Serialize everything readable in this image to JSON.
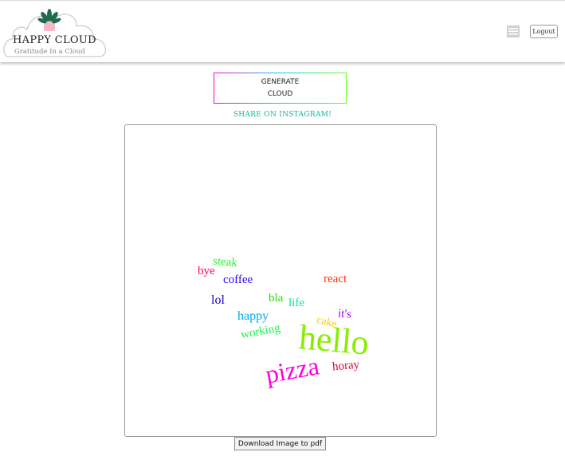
{
  "header": {
    "logo_title": "HAPPY CLOUD",
    "logo_tagline": "Gratitude In a Cloud",
    "logout_label": "Logout",
    "menu_icon": "hamburger-menu-icon"
  },
  "main": {
    "generate_line1": "GENERATE",
    "generate_line2": "CLOUD",
    "share_label": "SHARE ON INSTAGRAM!",
    "download_label": "Download Image to pdf"
  },
  "word_cloud": {
    "words": [
      {
        "text": "steak",
        "color": "#33ee33"
      },
      {
        "text": "bye",
        "color": "#ff0066"
      },
      {
        "text": "coffee",
        "color": "#3300ff"
      },
      {
        "text": "react",
        "color": "#ff3300"
      },
      {
        "text": "lol",
        "color": "#1a00cc"
      },
      {
        "text": "bla",
        "color": "#22dd00"
      },
      {
        "text": "life",
        "color": "#00ee99"
      },
      {
        "text": "happy",
        "color": "#00aaee"
      },
      {
        "text": "it's",
        "color": "#aa00ff"
      },
      {
        "text": "cake",
        "color": "#ffcc00"
      },
      {
        "text": "working",
        "color": "#22ee55"
      },
      {
        "text": "hello",
        "color": "#88ee00"
      },
      {
        "text": "pizza",
        "color": "#ff00dd"
      },
      {
        "text": "horay",
        "color": "#ee0033"
      }
    ]
  },
  "colors": {
    "share_link": "#10b99a",
    "button_border_gradient": [
      "#ff00cc",
      "#00ccff",
      "#66ff00"
    ]
  }
}
